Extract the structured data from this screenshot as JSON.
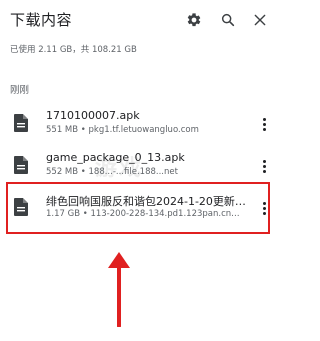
{
  "header": {
    "title": "下载内容",
    "storage_text": "已使用 2.11 GB，共 108.21 GB"
  },
  "icons": {
    "settings": "gear-icon",
    "search": "search-icon",
    "close": "close-icon"
  },
  "section": {
    "label": "刚刚"
  },
  "downloads": [
    {
      "name": "1710100007.apk",
      "meta": "551 MB • pkg1.tf.letuowangluo.com"
    },
    {
      "name": "game_package_0_13.apk",
      "meta": "552 MB • 188...-...file.188...net"
    },
    {
      "name": "绯色回响国服反和谐包2024-1-20更新…",
      "meta": "1.17 GB • 113-200-228-134.pd1.123pan.cn…"
    }
  ],
  "colors": {
    "highlight": "#e02020",
    "text_primary": "#202124",
    "text_secondary": "#5f6368"
  }
}
